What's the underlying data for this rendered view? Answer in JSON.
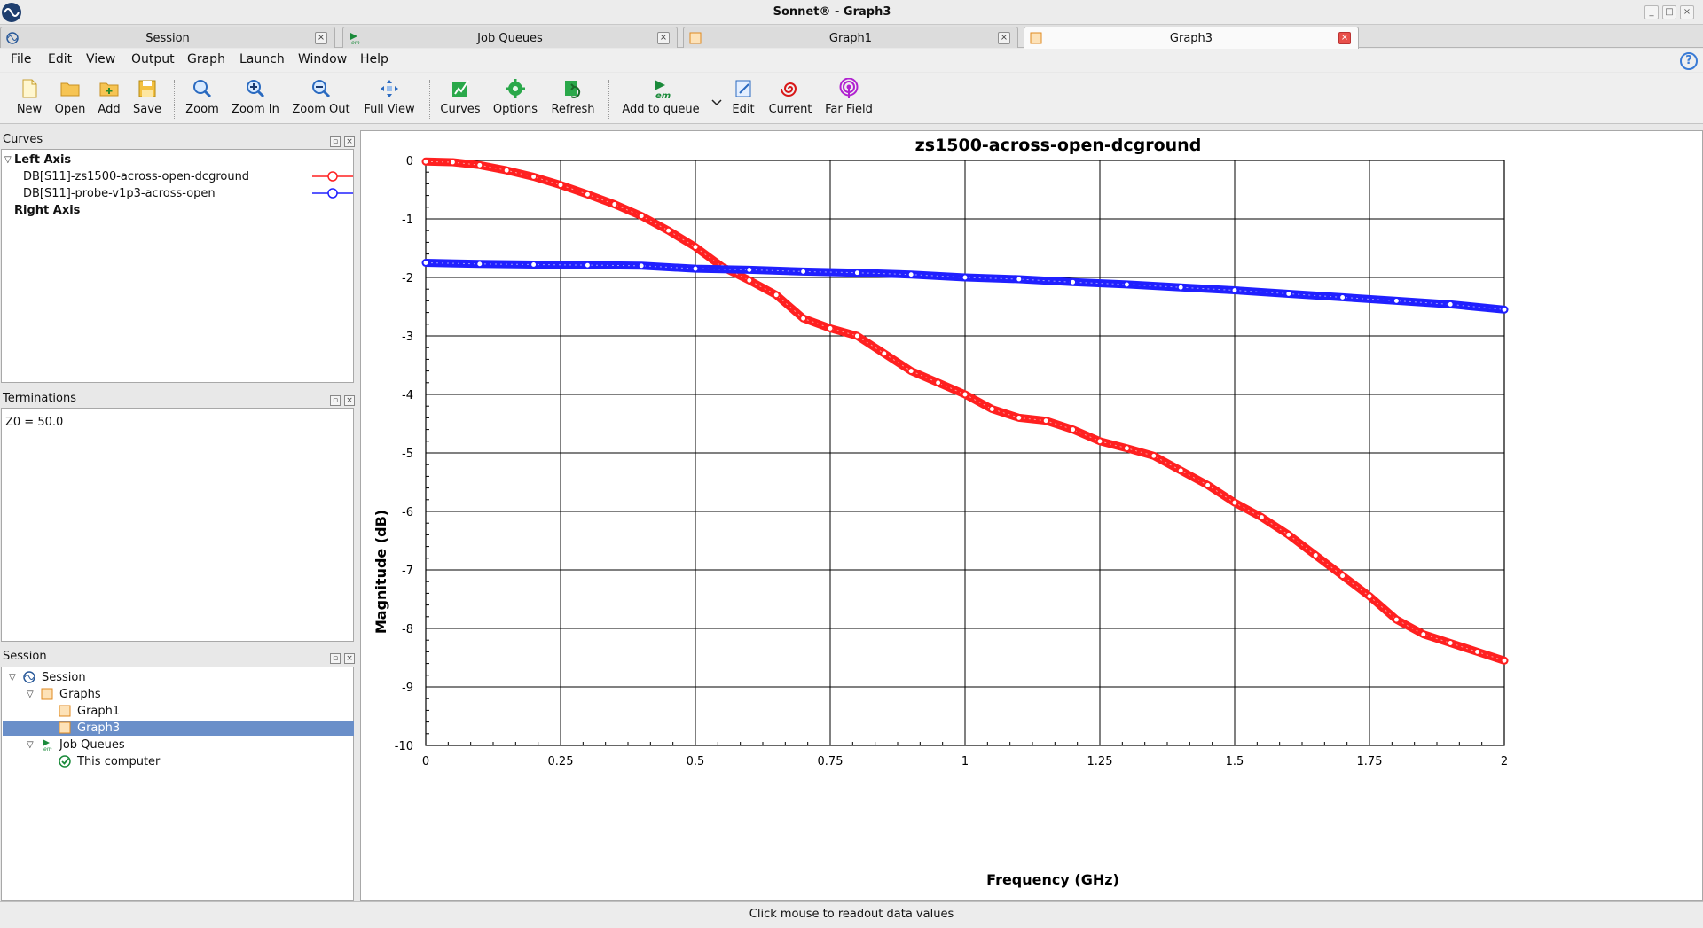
{
  "window": {
    "title": "Sonnet® - Graph3"
  },
  "tabs": [
    {
      "label": "Session",
      "icon": "sonnet-logo-icon"
    },
    {
      "label": "Job Queues",
      "icon": "em-run-icon"
    },
    {
      "label": "Graph1",
      "icon": "graph-doc-icon"
    },
    {
      "label": "Graph3",
      "icon": "graph-doc-icon",
      "active": true
    }
  ],
  "menu": [
    "File",
    "Edit",
    "View",
    "Output",
    "Graph",
    "Launch",
    "Window",
    "Help"
  ],
  "toolbar": [
    {
      "label": "New",
      "icon": "new-file-icon"
    },
    {
      "label": "Open",
      "icon": "open-folder-icon"
    },
    {
      "label": "Add",
      "icon": "add-folder-icon"
    },
    {
      "label": "Save",
      "icon": "save-icon"
    },
    {
      "label": "Zoom",
      "icon": "zoom-icon"
    },
    {
      "label": "Zoom In",
      "icon": "zoom-in-icon"
    },
    {
      "label": "Zoom Out",
      "icon": "zoom-out-icon"
    },
    {
      "label": "Full View",
      "icon": "full-view-icon"
    },
    {
      "label": "Curves",
      "icon": "curves-icon"
    },
    {
      "label": "Options",
      "icon": "options-icon"
    },
    {
      "label": "Refresh",
      "icon": "refresh-icon"
    },
    {
      "label": "Add to queue",
      "icon": "em-add-queue-icon"
    },
    {
      "label": "Edit",
      "icon": "edit-icon"
    },
    {
      "label": "Current",
      "icon": "current-icon"
    },
    {
      "label": "Far Field",
      "icon": "far-field-icon"
    }
  ],
  "panels": {
    "curves": {
      "title": "Curves",
      "left_axis": "Left Axis",
      "right_axis": "Right Axis",
      "items": [
        {
          "label": "DB[S11]-zs1500-across-open-dcground",
          "color": "#ff2020"
        },
        {
          "label": "DB[S11]-probe-v1p3-across-open",
          "color": "#2020ff"
        }
      ]
    },
    "terminations": {
      "title": "Terminations",
      "text": "Z0 = 50.0"
    },
    "session": {
      "title": "Session",
      "tree": {
        "root": "Session",
        "graphs": "Graphs",
        "graph1": "Graph1",
        "graph3": "Graph3",
        "job_queues": "Job Queues",
        "this_computer": "This computer"
      }
    }
  },
  "status": "Click mouse to readout data values",
  "chart_data": {
    "type": "line",
    "title": "zs1500-across-open-dcground",
    "xlabel": "Frequency (GHz)",
    "ylabel": "Magnitude (dB)",
    "xlim": [
      0,
      2
    ],
    "ylim": [
      -10,
      0
    ],
    "xticks": [
      "0",
      "0.25",
      "0.5",
      "0.75",
      "1",
      "1.25",
      "1.5",
      "1.75",
      "2"
    ],
    "yticks": [
      "0",
      "-1",
      "-2",
      "-3",
      "-4",
      "-5",
      "-6",
      "-7",
      "-8",
      "-9",
      "-10"
    ],
    "grid": true,
    "series": [
      {
        "name": "DB[S11]-zs1500-across-open-dcground",
        "color": "#ff2020",
        "x": [
          0,
          0.05,
          0.1,
          0.15,
          0.2,
          0.25,
          0.3,
          0.35,
          0.4,
          0.45,
          0.5,
          0.55,
          0.6,
          0.65,
          0.7,
          0.75,
          0.8,
          0.85,
          0.9,
          0.95,
          1.0,
          1.05,
          1.1,
          1.15,
          1.2,
          1.25,
          1.3,
          1.35,
          1.4,
          1.45,
          1.5,
          1.55,
          1.6,
          1.65,
          1.7,
          1.75,
          1.8,
          1.85,
          1.9,
          1.95,
          2.0
        ],
        "y": [
          -0.02,
          -0.03,
          -0.08,
          -0.17,
          -0.28,
          -0.42,
          -0.58,
          -0.75,
          -0.95,
          -1.2,
          -1.48,
          -1.82,
          -2.05,
          -2.3,
          -2.7,
          -2.87,
          -3.0,
          -3.3,
          -3.6,
          -3.8,
          -4.0,
          -4.25,
          -4.4,
          -4.45,
          -4.6,
          -4.8,
          -4.92,
          -5.05,
          -5.3,
          -5.55,
          -5.85,
          -6.1,
          -6.4,
          -6.75,
          -7.1,
          -7.45,
          -7.85,
          -8.1,
          -8.25,
          -8.4,
          -8.55
        ]
      },
      {
        "name": "DB[S11]-probe-v1p3-across-open",
        "color": "#2020ff",
        "x": [
          0,
          0.1,
          0.2,
          0.3,
          0.4,
          0.5,
          0.6,
          0.7,
          0.8,
          0.9,
          1.0,
          1.1,
          1.2,
          1.3,
          1.4,
          1.5,
          1.6,
          1.7,
          1.8,
          1.9,
          2.0
        ],
        "y": [
          -1.75,
          -1.77,
          -1.78,
          -1.79,
          -1.8,
          -1.85,
          -1.87,
          -1.9,
          -1.92,
          -1.95,
          -2.0,
          -2.03,
          -2.08,
          -2.12,
          -2.17,
          -2.22,
          -2.28,
          -2.34,
          -2.4,
          -2.46,
          -2.55
        ]
      }
    ]
  }
}
